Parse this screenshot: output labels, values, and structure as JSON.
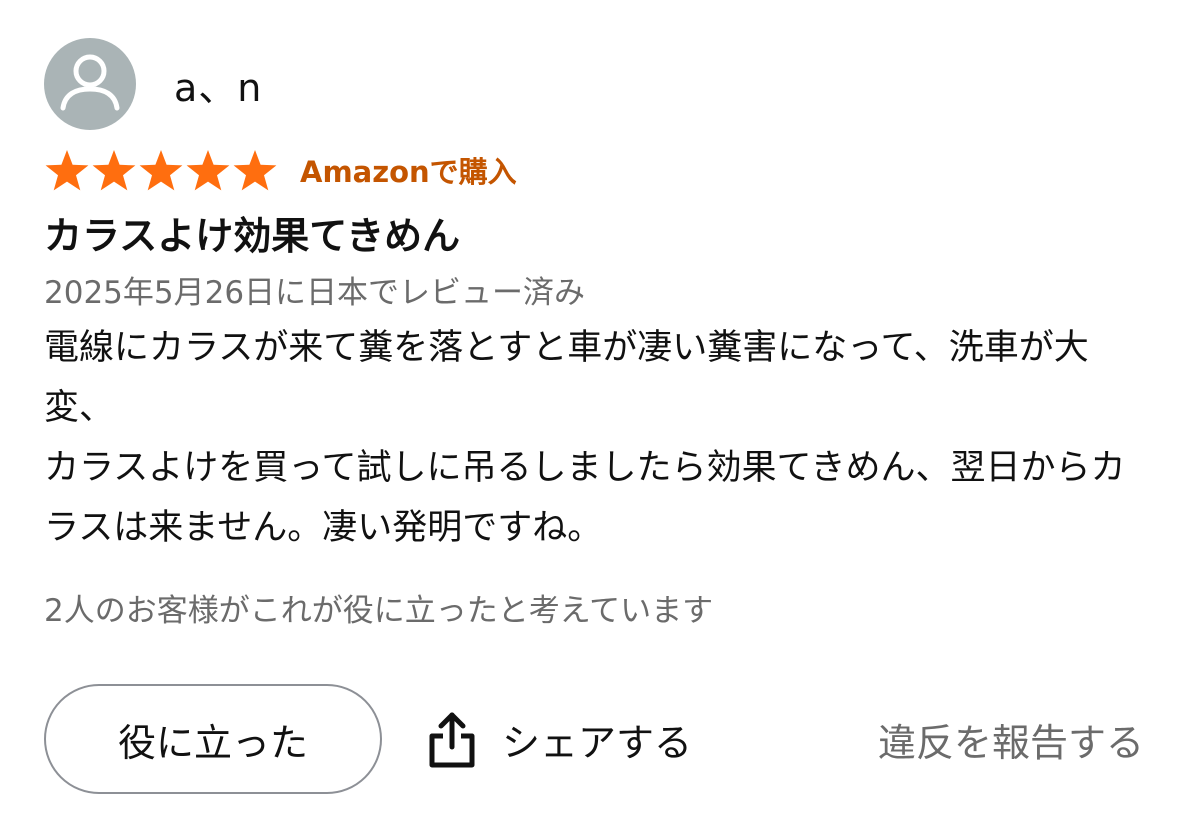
{
  "reviewer": {
    "name": "a、n"
  },
  "rating": {
    "stars": 5,
    "max": 5,
    "star_color": "#ff6e0f",
    "purchase_badge": "Amazonで購入",
    "badge_color": "#c45500"
  },
  "review": {
    "title": "カラスよけ効果てきめん",
    "date": "2025年5月26日に日本でレビュー済み",
    "body_lines": [
      "電線にカラスが来て糞を落とすと車が凄い糞害になって、洗車が大変、",
      "カラスよけを買って試しに吊るしましたら効果てきめん、翌日からカラスは来ません。凄い発明ですね。"
    ],
    "helpful_count_text": "2人のお客様がこれが役に立ったと考えています"
  },
  "actions": {
    "helpful_label": "役に立った",
    "share_label": "シェアする",
    "report_label": "違反を報告する"
  },
  "icons": {
    "avatar": "person-icon",
    "share": "share-icon",
    "star": "star-icon"
  }
}
